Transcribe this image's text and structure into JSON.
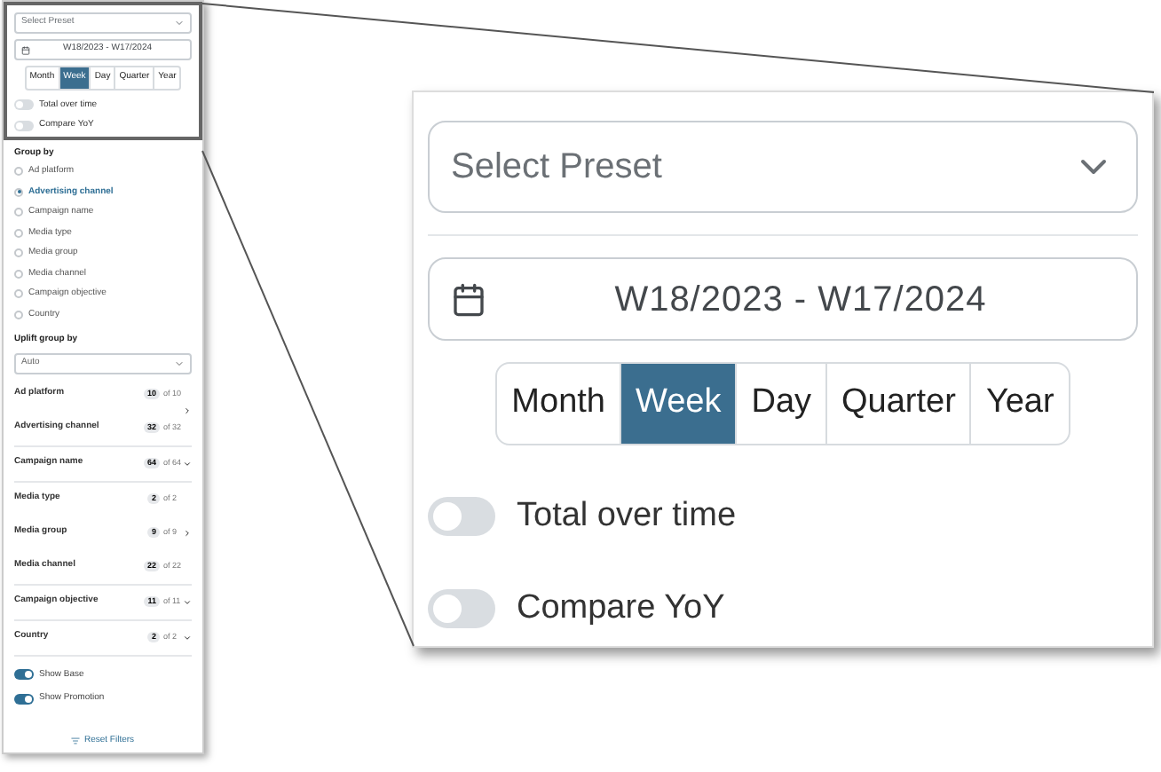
{
  "sidebar": {
    "preset": {
      "placeholder": "Select Preset"
    },
    "date_range": "W18/2023 - W17/2024",
    "periods": [
      {
        "label": "Month",
        "selected": false
      },
      {
        "label": "Week",
        "selected": true
      },
      {
        "label": "Day",
        "selected": false
      },
      {
        "label": "Quarter",
        "selected": false
      },
      {
        "label": "Year",
        "selected": false
      }
    ],
    "toggles": [
      {
        "label": "Total over time",
        "on": false
      },
      {
        "label": "Compare YoY",
        "on": false
      }
    ],
    "group_by": {
      "title": "Group by",
      "options": [
        {
          "label": "Ad platform",
          "selected": false
        },
        {
          "label": "Advertising channel",
          "selected": true
        },
        {
          "label": "Campaign name",
          "selected": false
        },
        {
          "label": "Media type",
          "selected": false
        },
        {
          "label": "Media group",
          "selected": false
        },
        {
          "label": "Media channel",
          "selected": false
        },
        {
          "label": "Campaign objective",
          "selected": false
        },
        {
          "label": "Country",
          "selected": false
        }
      ]
    },
    "uplift": {
      "title": "Uplift group by",
      "value": "Auto"
    },
    "filter_groups": [
      {
        "kind": "right",
        "items": [
          {
            "label": "Ad platform",
            "count": "10",
            "total": "of 10"
          },
          {
            "label": "Advertising channel",
            "count": "32",
            "total": "of 32"
          }
        ]
      },
      {
        "kind": "down",
        "items": [
          {
            "label": "Campaign name",
            "count": "64",
            "total": "of 64"
          }
        ]
      },
      {
        "kind": "right",
        "items": [
          {
            "label": "Media type",
            "count": "2",
            "total": "of 2"
          },
          {
            "label": "Media group",
            "count": "9",
            "total": "of 9"
          },
          {
            "label": "Media channel",
            "count": "22",
            "total": "of 22"
          }
        ]
      },
      {
        "kind": "down",
        "items": [
          {
            "label": "Campaign objective",
            "count": "11",
            "total": "of 11"
          }
        ]
      },
      {
        "kind": "down",
        "items": [
          {
            "label": "Country",
            "count": "2",
            "total": "of 2"
          }
        ]
      }
    ],
    "display_toggles": [
      {
        "label": "Show Base",
        "on": true
      },
      {
        "label": "Show Promotion",
        "on": true
      }
    ],
    "reset_button": "Reset Filters"
  },
  "zoom_callout": {
    "preset": {
      "placeholder": "Select Preset"
    },
    "date_range": "W18/2023 - W17/2024",
    "periods": [
      {
        "label": "Month",
        "selected": false
      },
      {
        "label": "Week",
        "selected": true
      },
      {
        "label": "Day",
        "selected": false
      },
      {
        "label": "Quarter",
        "selected": false
      },
      {
        "label": "Year",
        "selected": false
      }
    ],
    "toggles": [
      {
        "label": "Total over time",
        "on": false
      },
      {
        "label": "Compare YoY",
        "on": false
      }
    ]
  }
}
